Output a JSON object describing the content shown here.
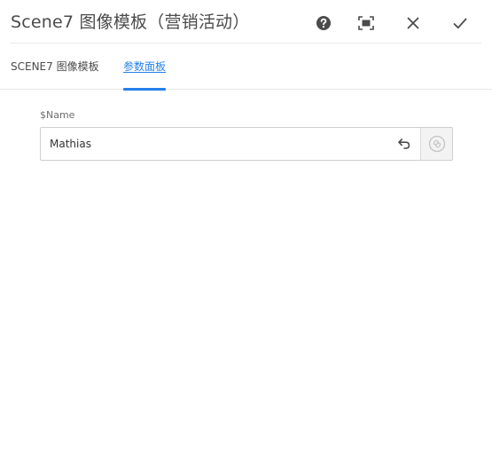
{
  "dialog": {
    "title": "Scene7 图像模板（营销活动）",
    "actions": {
      "help": "help-icon",
      "fullscreen": "fullscreen-icon",
      "close": "close-icon",
      "done": "checkmark-icon"
    }
  },
  "tabs": [
    {
      "label": "SCENE7 图像模板",
      "active": false
    },
    {
      "label": "参数面板",
      "active": true
    }
  ],
  "form": {
    "name_field": {
      "label": "$Name",
      "value": "Mathias",
      "revert_icon": "undo-icon",
      "addon_icon": "link-icon"
    }
  },
  "colors": {
    "accent": "#2680eb",
    "text": "#4b4b4b",
    "border": "#cfcfcf"
  }
}
